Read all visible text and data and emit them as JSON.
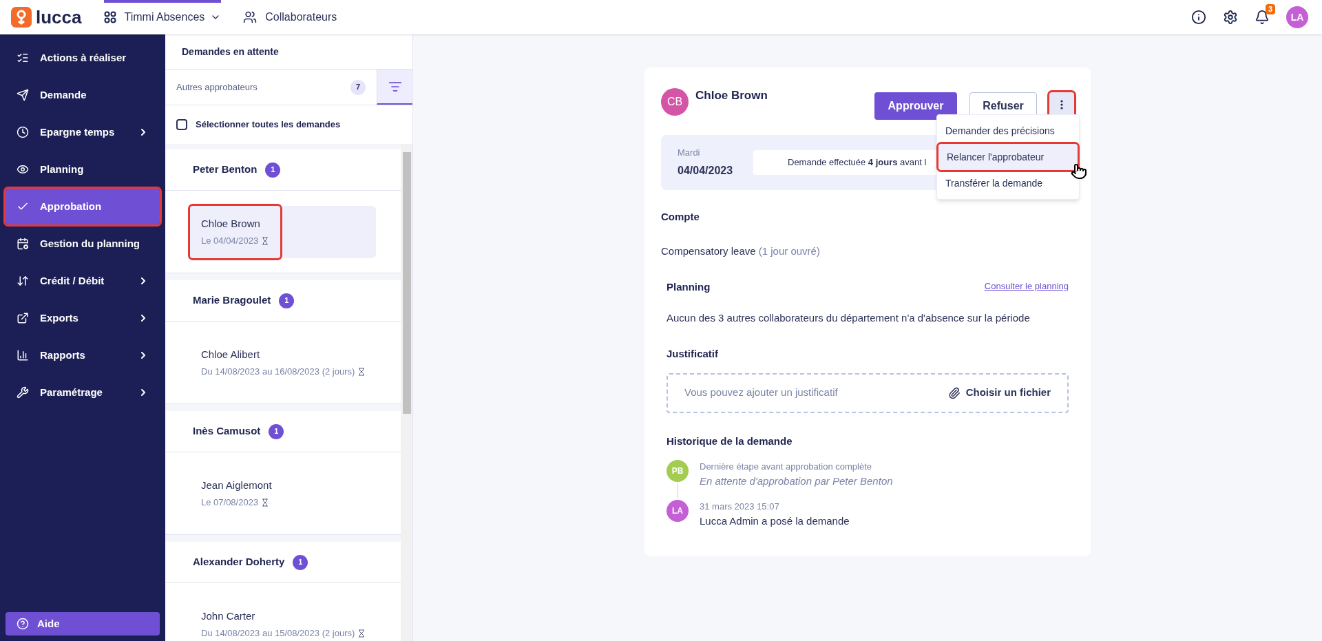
{
  "topbar": {
    "logo": "lucca",
    "app": "Timmi Absences",
    "people": "Collaborateurs",
    "notifications": "3",
    "avatar": "LA"
  },
  "sidebar": {
    "items": [
      {
        "label": "Actions à réaliser",
        "submenu": false,
        "selected": false,
        "highlighted": false
      },
      {
        "label": "Demande",
        "submenu": false,
        "selected": false,
        "highlighted": false
      },
      {
        "label": "Epargne temps",
        "submenu": true,
        "selected": false,
        "highlighted": false
      },
      {
        "label": "Planning",
        "submenu": false,
        "selected": false,
        "highlighted": false
      },
      {
        "label": "Approbation",
        "submenu": false,
        "selected": true,
        "highlighted": true
      },
      {
        "label": "Gestion du planning",
        "submenu": false,
        "selected": false,
        "highlighted": false
      },
      {
        "label": "Crédit / Débit",
        "submenu": true,
        "selected": false,
        "highlighted": false
      },
      {
        "label": "Exports",
        "submenu": true,
        "selected": false,
        "highlighted": false
      },
      {
        "label": "Rapports",
        "submenu": true,
        "selected": false,
        "highlighted": false
      },
      {
        "label": "Paramétrage",
        "submenu": true,
        "selected": false,
        "highlighted": false
      }
    ],
    "help": "Aide"
  },
  "list": {
    "title": "Demandes en attente",
    "filter": {
      "label": "Autres approbateurs",
      "count": "7"
    },
    "select_all": {
      "label": "Sélectionner toutes les demandes",
      "checked": false
    },
    "groups": [
      {
        "name": "Peter Benton",
        "count": "1",
        "requests": [
          {
            "name": "Chloe Brown",
            "dates": "Le 04/04/2023",
            "selected": true,
            "highlighted": true
          }
        ]
      },
      {
        "name": "Marie Bragoulet",
        "count": "1",
        "requests": [
          {
            "name": "Chloe Alibert",
            "dates": "Du 14/08/2023 au 16/08/2023 (2 jours)",
            "selected": false,
            "highlighted": false
          }
        ]
      },
      {
        "name": "Inès Camusot",
        "count": "1",
        "requests": [
          {
            "name": "Jean Aiglemont",
            "dates": "Le 07/08/2023",
            "selected": false,
            "highlighted": false
          }
        ]
      },
      {
        "name": "Alexander Doherty",
        "count": "1",
        "requests": [
          {
            "name": "John Carter",
            "dates": "Du 14/08/2023 au 15/08/2023 (2 jours)",
            "selected": false,
            "highlighted": false
          }
        ]
      }
    ]
  },
  "detail": {
    "avatar": {
      "initials": "CB",
      "color": "#d455a6"
    },
    "name": "Chloe Brown",
    "approve": "Approuver",
    "refuse": "Refuser",
    "more_highlighted": true,
    "menu": [
      {
        "label": "Demander des précisions",
        "highlighted": false
      },
      {
        "label": "Relancer l'approbateur",
        "highlighted": true
      },
      {
        "label": "Transférer la demande",
        "highlighted": false
      }
    ],
    "banner": {
      "day": "Mardi",
      "date": "04/04/2023",
      "note": "Demande effectuée **4 jours** avant l"
    },
    "account": {
      "title": "Compte",
      "name": "Compensatory leave",
      "detail": "(1 jour ouvré)"
    },
    "planning": {
      "title": "Planning",
      "link": "Consulter le planning",
      "text": "Aucun des 3 autres collaborateurs du département n'a d'absence sur la période"
    },
    "attachment": {
      "title": "Justificatif",
      "placeholder": "Vous pouvez ajouter un justificatif",
      "button": "Choisir un fichier"
    },
    "history": {
      "title": "Historique de la demande",
      "entries": [
        {
          "initials": "PB",
          "color": "#a3cd50",
          "caption": "Dernière étape avant approbation complète",
          "text": "En attente d'approbation par Peter Benton",
          "kind": "pending"
        },
        {
          "initials": "LA",
          "color": "#c45fd6",
          "caption": "31 mars 2023 15:07",
          "text": "Lucca Admin a posé la demande",
          "kind": "done"
        }
      ]
    }
  }
}
